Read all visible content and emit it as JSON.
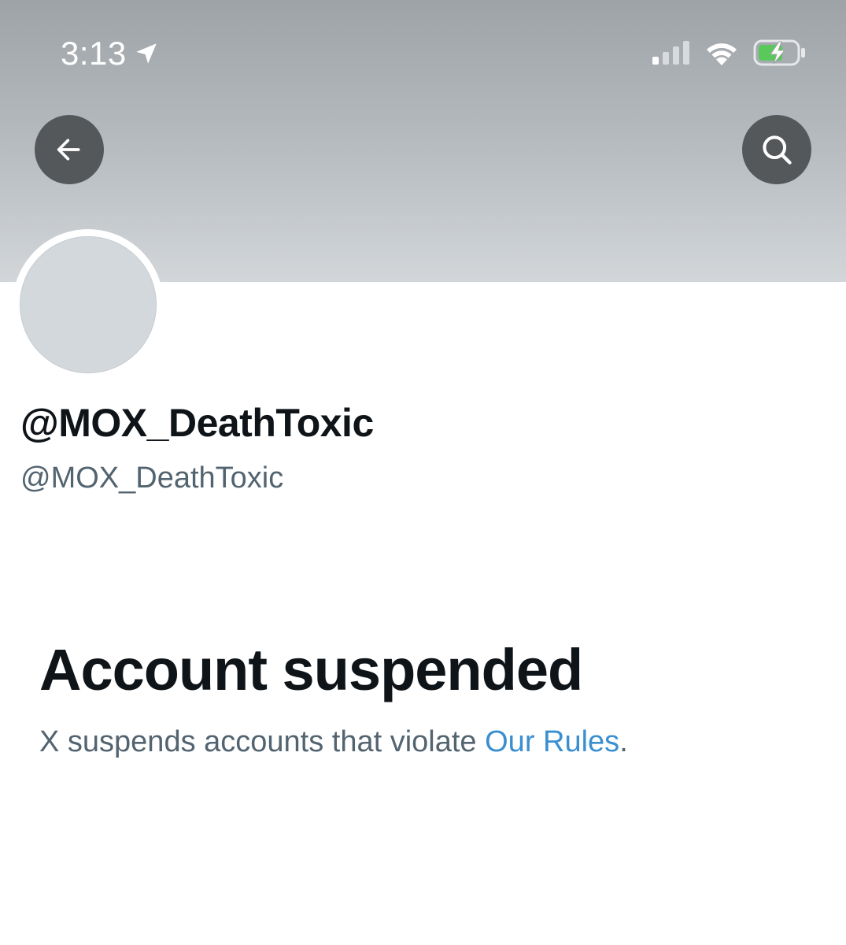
{
  "status_bar": {
    "time": "3:13",
    "icons": [
      "location-arrow-icon",
      "cellular-signal-icon",
      "wifi-icon",
      "battery-charging-icon"
    ]
  },
  "nav": {
    "back_icon": "arrow-left-icon",
    "search_icon": "search-icon"
  },
  "profile": {
    "display_name": "@MOX_DeathToxic",
    "handle": "@MOX_DeathToxic"
  },
  "suspension": {
    "title": "Account suspended",
    "message_prefix": "X suspends accounts that violate ",
    "rules_link": "Our Rules",
    "message_suffix": "."
  },
  "colors": {
    "banner_top": "#9ea3a7",
    "banner_bottom": "#d2d6d9",
    "nav_button": "#55585b",
    "avatar_placeholder": "#d3d8dc",
    "text_primary": "#0f1419",
    "text_secondary": "#536471",
    "link": "#3a8fd0",
    "battery_fill": "#5ac85a"
  }
}
